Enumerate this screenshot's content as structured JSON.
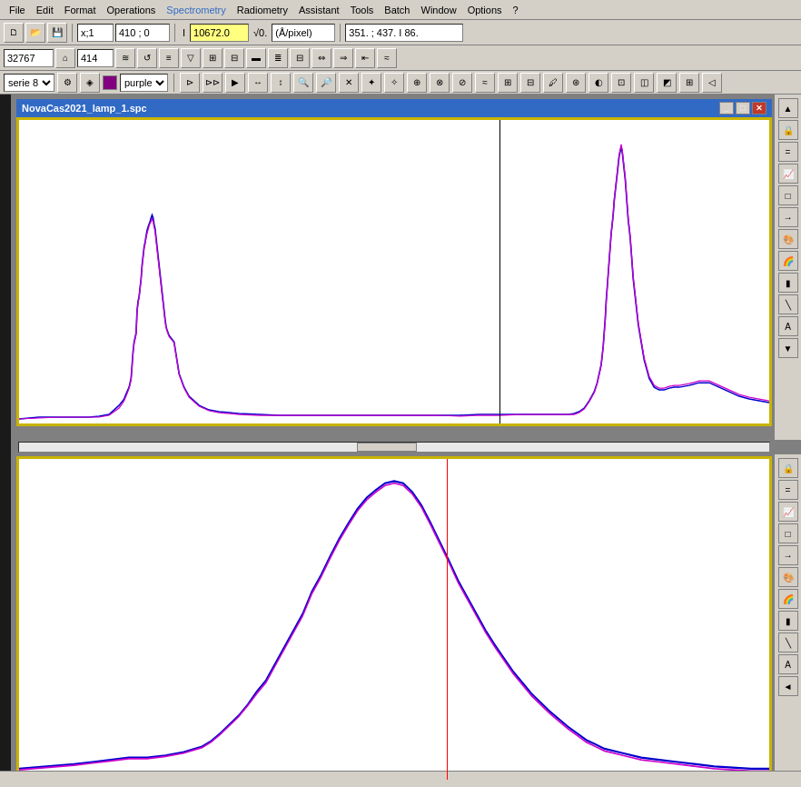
{
  "menubar": {
    "items": [
      "File",
      "Edit",
      "Format",
      "Operations",
      "Spectrometry",
      "Radiometry",
      "Assistant",
      "Tools",
      "Batch",
      "Window",
      "Options",
      "?"
    ]
  },
  "toolbar1": {
    "x_label": "x;1",
    "x_value": "410 ; 0",
    "intensity_label": "I",
    "intensity_value": "10672.0",
    "angstrom_label": "√0.",
    "angstrom_unit": "(Å/pixel)",
    "coords": "351. ; 437. I 86."
  },
  "toolbar2": {
    "val1": "32767",
    "val2": "414"
  },
  "series": {
    "name": "serie 8",
    "color": "purple",
    "color_hex": "#800080"
  },
  "window": {
    "title": "NovaCas2021_lamp_1.spc"
  },
  "statusbar": {
    "text": ""
  }
}
